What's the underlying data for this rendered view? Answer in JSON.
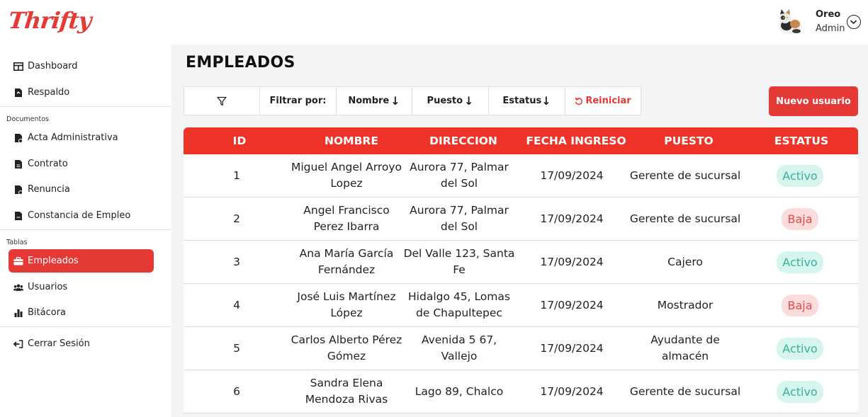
{
  "brand": {
    "logo_text": "Thrifty",
    "color": "#e53935"
  },
  "user": {
    "name": "Oreo",
    "role": "Admin"
  },
  "sidebar": {
    "top_items": [
      {
        "label": "Dashboard",
        "icon": "table-icon"
      },
      {
        "label": "Respaldo",
        "icon": "file-backup-icon"
      }
    ],
    "documentos_label": "Documentos",
    "documentos_items": [
      {
        "label": "Acta Administrativa",
        "icon": "file-icon"
      },
      {
        "label": "Contrato",
        "icon": "file-icon"
      },
      {
        "label": "Renuncia",
        "icon": "file-icon"
      },
      {
        "label": "Constancia de Empleo",
        "icon": "file-icon"
      }
    ],
    "tablas_label": "Tablas",
    "tablas_items": [
      {
        "label": "Empleados",
        "icon": "briefcase-icon",
        "active": true
      },
      {
        "label": "Usuarios",
        "icon": "users-icon"
      },
      {
        "label": "Bitácora",
        "icon": "bar-chart-icon"
      }
    ],
    "logout_label": "Cerrar Sesión"
  },
  "main": {
    "title": "EMPLEADOS",
    "filters": {
      "filter_icon": "filter-icon",
      "filter_by_label": "Filtrar por:",
      "nombre_label": "Nombre",
      "puesto_label": "Puesto",
      "estatus_label": "Estatus",
      "reset_label": "Reiniciar"
    },
    "new_user_label": "Nuevo usuario",
    "table": {
      "headers": [
        "ID",
        "NOMBRE",
        "DIRECCION",
        "FECHA INGRESO",
        "PUESTO",
        "ESTATUS"
      ],
      "rows": [
        {
          "id": "1",
          "nombre": "Miguel Angel Arroyo Lopez",
          "direccion": "Aurora 77, Palmar del Sol",
          "fecha": "17/09/2024",
          "puesto": "Gerente de sucursal",
          "estatus": "Activo"
        },
        {
          "id": "2",
          "nombre": "Angel Francisco Perez Ibarra",
          "direccion": "Aurora 77, Palmar del Sol",
          "fecha": "17/09/2024",
          "puesto": "Gerente de sucursal",
          "estatus": "Baja"
        },
        {
          "id": "3",
          "nombre": "Ana María García Fernández",
          "direccion": "Del Valle 123, Santa Fe",
          "fecha": "17/09/2024",
          "puesto": "Cajero",
          "estatus": "Activo"
        },
        {
          "id": "4",
          "nombre": "José Luis Martínez López",
          "direccion": "Hidalgo 45, Lomas de Chapultepec",
          "fecha": "17/09/2024",
          "puesto": "Mostrador",
          "estatus": "Baja"
        },
        {
          "id": "5",
          "nombre": "Carlos Alberto Pérez Gómez",
          "direccion": "Avenida 5 67, Vallejo",
          "fecha": "17/09/2024",
          "puesto": "Ayudante de almacén",
          "estatus": "Activo"
        },
        {
          "id": "6",
          "nombre": "Sandra Elena Mendoza Rivas",
          "direccion": "Lago 89, Chalco",
          "fecha": "17/09/2024",
          "puesto": "Gerente de sucursal",
          "estatus": "Activo"
        }
      ]
    }
  },
  "colors": {
    "accent": "#e53935",
    "header_red": "#ee3428",
    "activo_bg": "#d6f5ef",
    "activo_text": "#39b29a",
    "baja_bg": "#fbdcdc",
    "baja_text": "#e34b4b"
  }
}
